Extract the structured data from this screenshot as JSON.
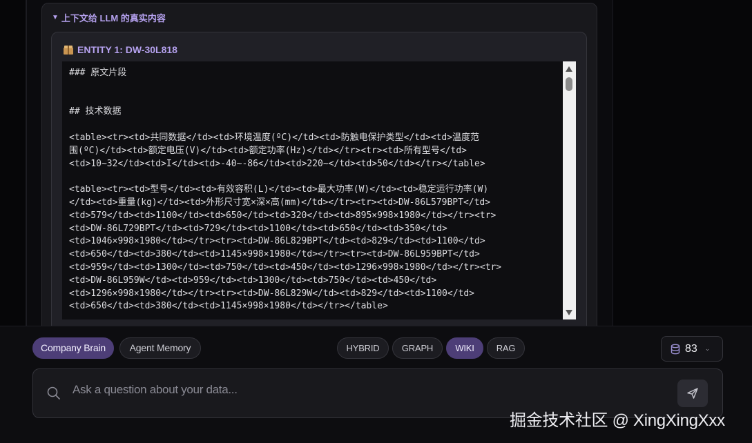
{
  "context_panel": {
    "header": "上下文给 LLM 的真实内容",
    "entity": {
      "title": "ENTITY 1: DW-30L818",
      "raw_text": "### 原文片段\n\n\n## 技术数据\n\n<table><tr><td>共同数据</td><td>环境温度(ºC)</td><td>防触电保护类型</td><td>温度范\n围(ºC)</td><td>额定电压(V)</td><td>额定功率(Hz)</td></tr><tr><td>所有型号</td>\n<td>10~32</td><td>I</td><td>-40~-86</td><td>220~</td><td>50</td></tr></table>\n\n<table><tr><td>型号</td><td>有效容积(L)</td><td>最大功率(W)</td><td>稳定运行功率(W)\n</td><td>重量(kg)</td><td>外形尺寸宽×深×高(mm)</td></tr><tr><td>DW-86L579BPT</td>\n<td>579</td><td>1100</td><td>650</td><td>320</td><td>895×998×1980</td></tr><tr>\n<td>DW-86L729BPT</td><td>729</td><td>1100</td><td>650</td><td>350</td>\n<td>1046×998×1980</td></tr><tr><td>DW-86L829BPT</td><td>829</td><td>1100</td>\n<td>650</td><td>380</td><td>1145×998×1980</td></tr><tr><td>DW-86L959BPT</td>\n<td>959</td><td>1300</td><td>750</td><td>450</td><td>1296×998×1980</td></tr><tr>\n<td>DW-86L959W</td><td>959</td><td>1300</td><td>750</td><td>450</td>\n<td>1296×998×1980</td></tr><tr><td>DW-86L829W</td><td>829</td><td>1100</td>\n<td>650</td><td>380</td><td>1145×998×1980</td></tr></table>"
    }
  },
  "source_tabs": [
    {
      "label": "Company Brain",
      "active": true
    },
    {
      "label": "Agent Memory",
      "active": false
    }
  ],
  "mode_tabs": [
    {
      "label": "HYBRID",
      "active": false
    },
    {
      "label": "GRAPH",
      "active": false
    },
    {
      "label": "WIKI",
      "active": true
    },
    {
      "label": "RAG",
      "active": false
    }
  ],
  "counter": {
    "value": "83",
    "icon": "database-icon"
  },
  "ask": {
    "placeholder": "Ask a question about your data..."
  },
  "watermark": "掘金技术社区 @ XingXingXxx",
  "colors": {
    "accent": "#b6a2f0",
    "active_pill": "#4d3e77"
  }
}
